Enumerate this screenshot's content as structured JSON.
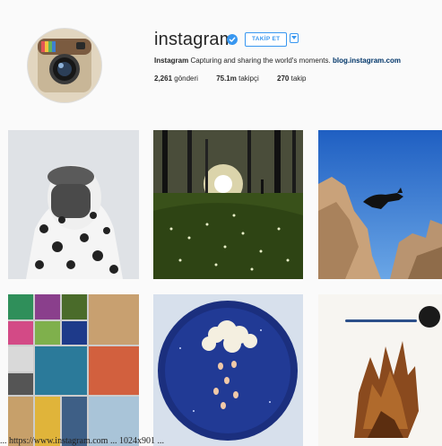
{
  "profile": {
    "username": "instagram",
    "follow_label": "TAKİP ET",
    "bio_name": "Instagram",
    "bio_text": " Capturing and sharing the world's moments. ",
    "bio_link": "blog.instagram.com",
    "stats": {
      "posts_count": "2,261",
      "posts_label": " gönderi",
      "followers_count": "75.1m",
      "followers_label": " takipçi",
      "following_count": "270",
      "following_label": " takip"
    }
  },
  "icons": {
    "avatar": "instagram-camera-logo",
    "verified": "verified-badge-icon",
    "dropdown": "chevron-down-icon"
  },
  "colors": {
    "accent": "#3897f0",
    "link": "#003569",
    "text": "#262626",
    "background": "#fafafa"
  },
  "grid": {
    "posts": [
      {
        "name": "post-masked-figure"
      },
      {
        "name": "post-forest-sunlight"
      },
      {
        "name": "post-cat-jumping-rocks"
      },
      {
        "name": "post-photo-collage"
      },
      {
        "name": "post-blue-cloud-painting"
      },
      {
        "name": "post-ink-watercolor"
      }
    ]
  },
  "caption": "... https://www.instagram.com ... 1024x901 ..."
}
